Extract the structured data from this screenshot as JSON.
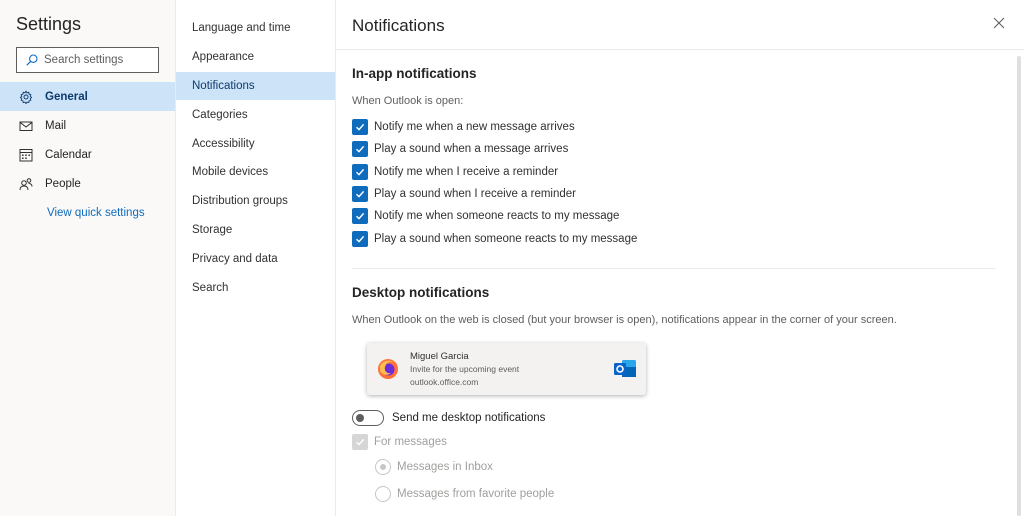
{
  "sidebar": {
    "title": "Settings",
    "search_placeholder": "Search settings",
    "items": [
      {
        "label": "General",
        "icon": "gear-icon"
      },
      {
        "label": "Mail",
        "icon": "mail-icon"
      },
      {
        "label": "Calendar",
        "icon": "calendar-icon"
      },
      {
        "label": "People",
        "icon": "people-icon"
      }
    ],
    "quick_settings_link": "View quick settings"
  },
  "subnav": {
    "items": [
      "Language and time",
      "Appearance",
      "Notifications",
      "Categories",
      "Accessibility",
      "Mobile devices",
      "Distribution groups",
      "Storage",
      "Privacy and data",
      "Search"
    ],
    "active": "Notifications"
  },
  "pane": {
    "title": "Notifications",
    "in_app": {
      "heading": "In-app notifications",
      "hint": "When Outlook is open:",
      "options": [
        {
          "label": "Notify me when a new message arrives",
          "checked": true
        },
        {
          "label": "Play a sound when a message arrives",
          "checked": true
        },
        {
          "label": "Notify me when I receive a reminder",
          "checked": true
        },
        {
          "label": "Play a sound when I receive a reminder",
          "checked": true
        },
        {
          "label": "Notify me when someone reacts to my message",
          "checked": true
        },
        {
          "label": "Play a sound when someone reacts to my message",
          "checked": true
        }
      ]
    },
    "desktop": {
      "heading": "Desktop notifications",
      "hint": "When Outlook on the web is closed (but your browser is open), notifications appear in the corner of your screen.",
      "preview": {
        "sender": "Miguel Garcia",
        "message": "Invite for the upcoming event",
        "source": "outlook.office.com"
      },
      "toggle_label": "Send me desktop notifications",
      "toggle_on": false,
      "for_messages_label": "For messages",
      "radio_inbox": "Messages in Inbox",
      "radio_favorites": "Messages from favorite people"
    }
  },
  "colors": {
    "accent": "#0f6cbd",
    "selected_bg": "#cce3f8",
    "disabled": "#a19f9d"
  }
}
